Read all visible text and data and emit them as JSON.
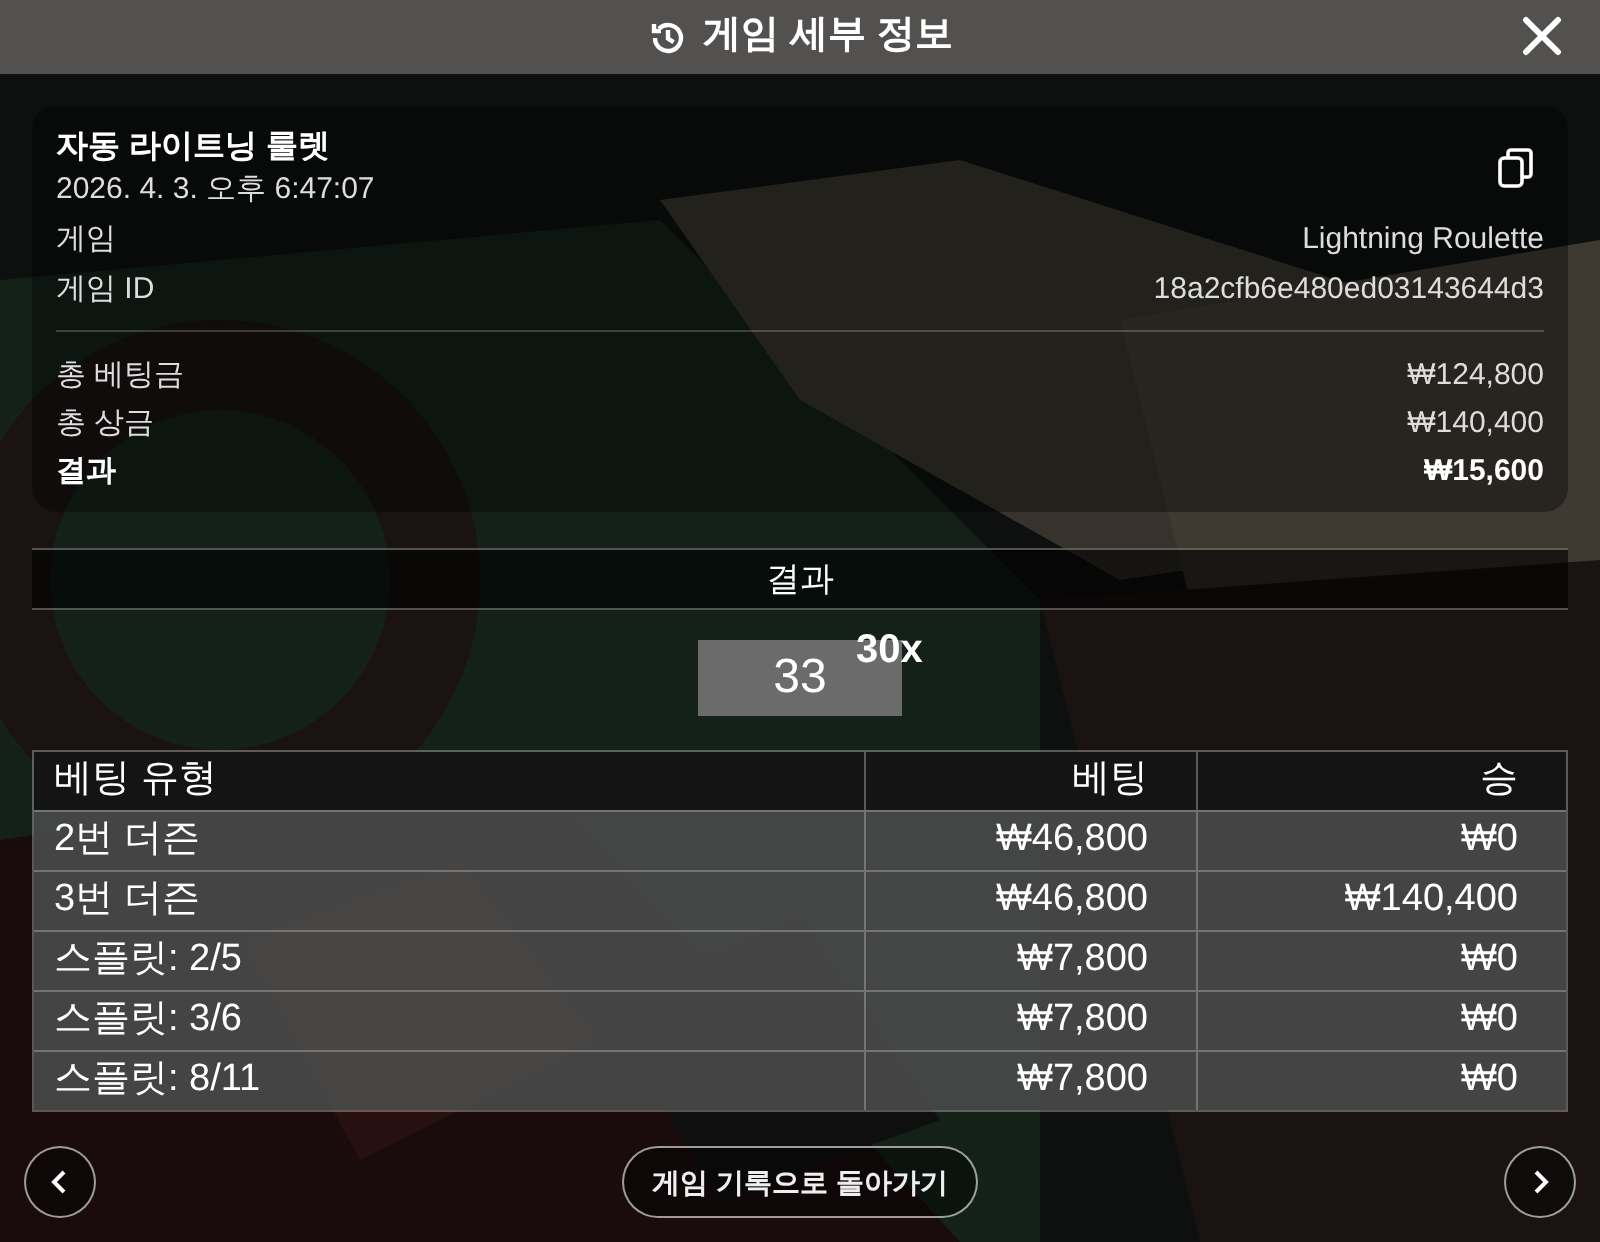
{
  "header": {
    "title": "게임 세부 정보"
  },
  "summary": {
    "game_name": "자동 라이트닝 룰렛",
    "datetime": "2026. 4. 3. 오후 6:47:07",
    "details": [
      {
        "label": "게임",
        "value": "Lightning Roulette"
      },
      {
        "label": "게임 ID",
        "value": "18a2cfb6e480ed03143644d3"
      }
    ],
    "totals": [
      {
        "label": "총 베팅금",
        "value": "₩124,800",
        "emphasis": false
      },
      {
        "label": "총 상금",
        "value": "₩140,400",
        "emphasis": false
      },
      {
        "label": "결과",
        "value": "₩15,600",
        "emphasis": true
      }
    ]
  },
  "result": {
    "title": "결과",
    "number": "33",
    "multiplier": "30x"
  },
  "bets": {
    "columns": [
      "베팅 유형",
      "베팅",
      "승"
    ],
    "rows": [
      [
        "2번 더즌",
        "₩46,800",
        "₩0"
      ],
      [
        "3번 더즌",
        "₩46,800",
        "₩140,400"
      ],
      [
        "스플릿: 2/5",
        "₩7,800",
        "₩0"
      ],
      [
        "스플릿: 3/6",
        "₩7,800",
        "₩0"
      ],
      [
        "스플릿: 8/11",
        "₩7,800",
        "₩0"
      ]
    ]
  },
  "footer": {
    "back_button": "게임 기록으로 돌아가기"
  }
}
